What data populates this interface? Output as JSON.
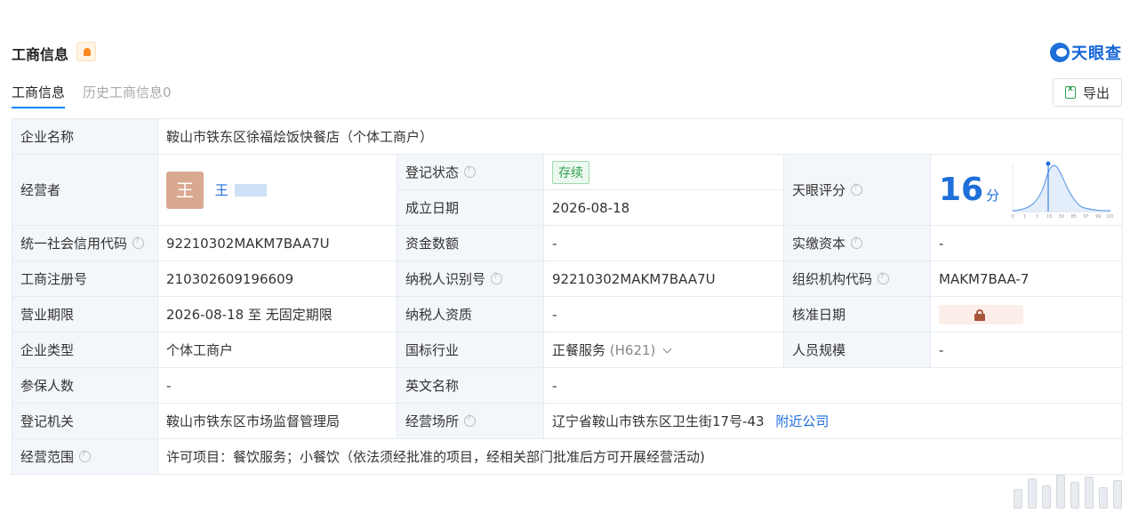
{
  "header": {
    "title": "工商信息",
    "brand": "天眼查",
    "tabs": [
      {
        "label": "工商信息"
      },
      {
        "label": "历史工商信息0"
      }
    ],
    "export_label": "导出"
  },
  "info": {
    "company_name_label": "企业名称",
    "company_name": "鞍山市铁东区徐福烩饭快餐店（个体工商户）",
    "operator_label": "经营者",
    "operator_avatar": "王",
    "operator_name": "王",
    "reg_status_label": "登记状态",
    "reg_status": "存续",
    "established_label": "成立日期",
    "established": "2026-08-18",
    "score_label": "天眼评分",
    "score": "16",
    "score_unit": "分",
    "credit_code_label": "统一社会信用代码",
    "credit_code": "92210302MAKM7BAA7U",
    "capital_label": "资金数额",
    "capital": "-",
    "paid_capital_label": "实缴资本",
    "paid_capital": "-",
    "reg_no_label": "工商注册号",
    "reg_no": "210302609196609",
    "taxpayer_id_label": "纳税人识别号",
    "taxpayer_id": "92210302MAKM7BAA7U",
    "org_code_label": "组织机构代码",
    "org_code": "MAKM7BAA-7",
    "term_label": "营业期限",
    "term": "2026-08-18 至 无固定期限",
    "taxpayer_qual_label": "纳税人资质",
    "taxpayer_qual": "-",
    "approval_date_label": "核准日期",
    "company_type_label": "企业类型",
    "company_type": "个体工商户",
    "industry_label": "国标行业",
    "industry": "正餐服务",
    "industry_code": "(H621)",
    "staff_size_label": "人员规模",
    "staff_size": "-",
    "insured_label": "参保人数",
    "insured": "-",
    "english_name_label": "英文名称",
    "english_name": "-",
    "authority_label": "登记机关",
    "authority": "鞍山市铁东区市场监督管理局",
    "address_label": "经营场所",
    "address": "辽宁省鞍山市铁东区卫生街17号-43",
    "nearby_label": "附近公司",
    "scope_label": "经营范围",
    "scope": "许可项目：餐饮服务；小餐饮（依法须经批准的项目，经相关部门批准后方可开展经营活动)"
  },
  "score_chart": {
    "x_ticks": [
      "0",
      "1",
      "3",
      "15",
      "50",
      "85",
      "97",
      "99",
      "100"
    ]
  }
}
